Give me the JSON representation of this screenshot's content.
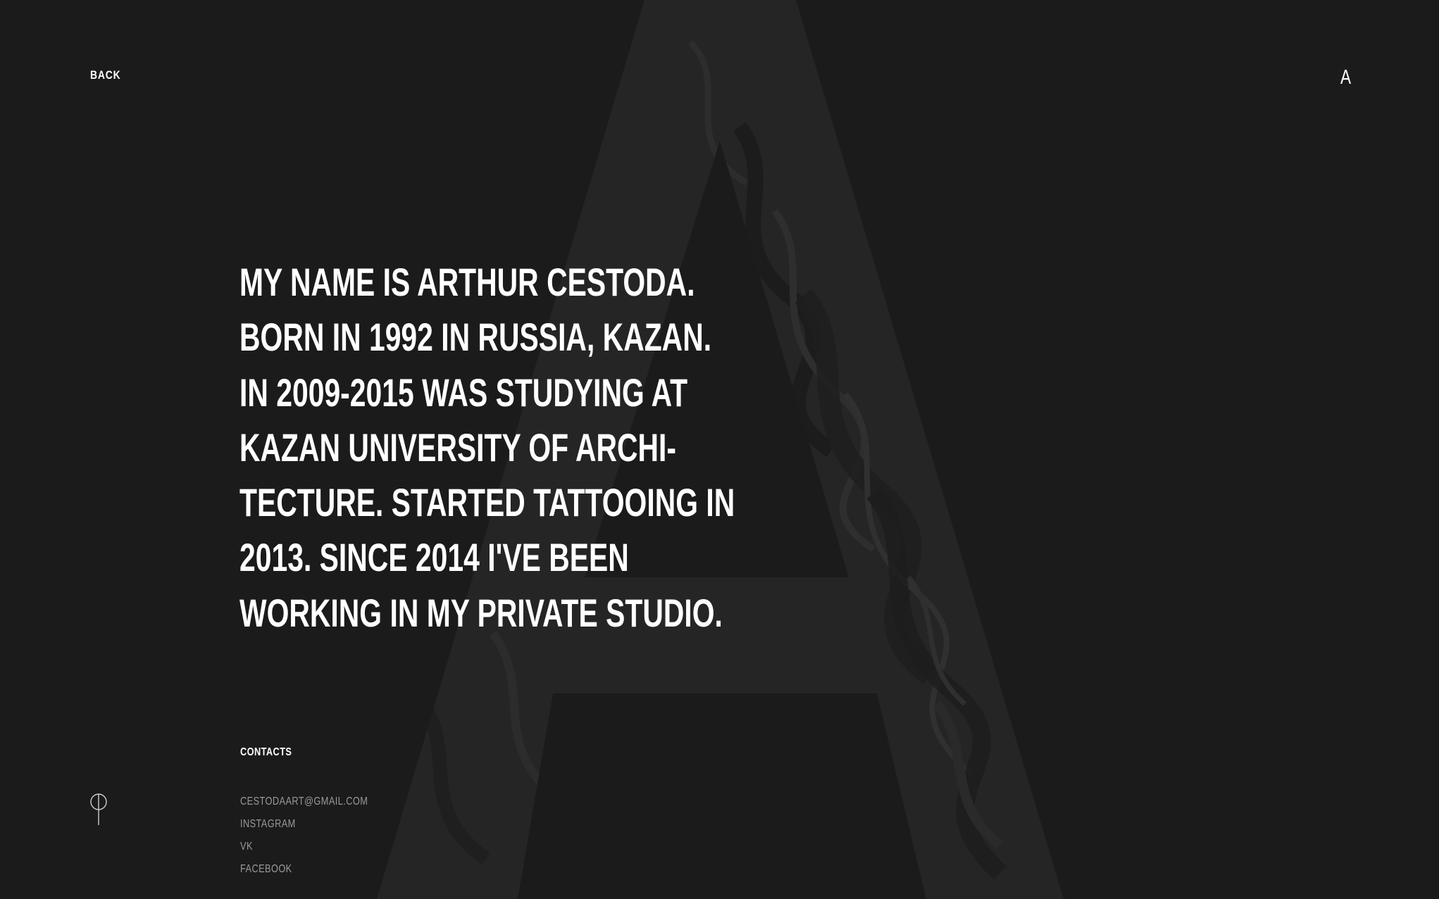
{
  "nav": {
    "back_label": "BACK",
    "logo_letter": "A"
  },
  "bio": {
    "lines": [
      "MY NAME IS ARTHUR CESTODA.",
      "BORN IN 1992 IN RUSSIA, KAZAN.",
      "IN 2009-2015 WAS STUDYING AT",
      "KAZAN UNIVERSITY OF ARCHI-",
      "TECTURE. STARTED TATTOOING IN",
      "2013. SINCE 2014 I'VE BEEN",
      "WORKING IN MY PRIVATE STUDIO."
    ]
  },
  "contacts": {
    "title": "CONTACTS",
    "items": [
      "CESTODAART@GMAIL.COM",
      "INSTAGRAM",
      "VK",
      "FACEBOOK"
    ]
  },
  "icons": {
    "background": "big-letter-a-marble-icon",
    "corner": "pin-icon"
  },
  "colors": {
    "background": "#1b1b1b",
    "text": "#ffffff",
    "muted": "#9a9a9a"
  }
}
